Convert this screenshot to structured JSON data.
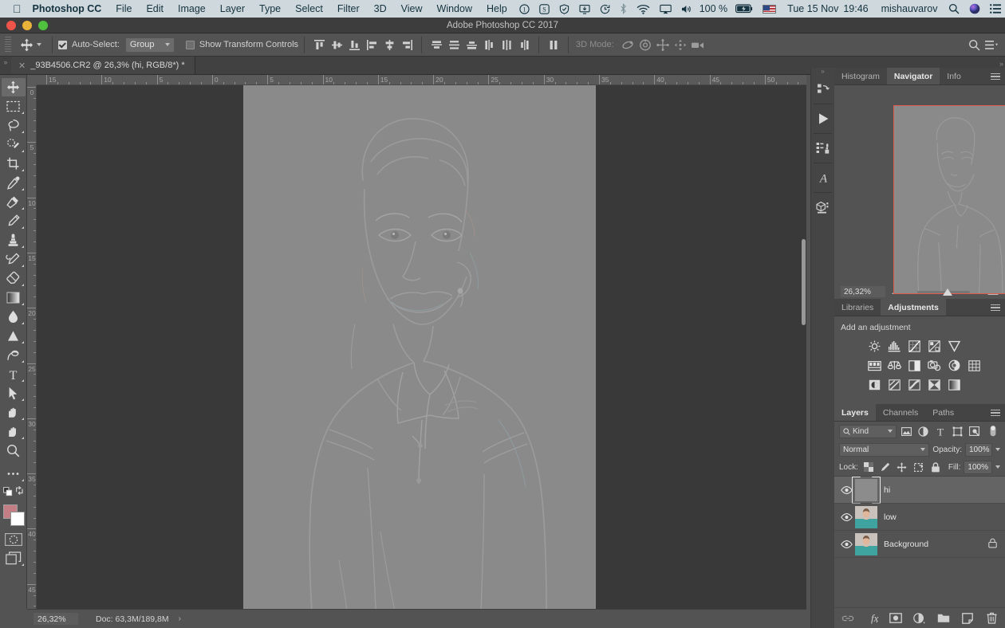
{
  "macbar": {
    "apple_icon": "apple-logo-icon",
    "menus": [
      "Photoshop CC",
      "File",
      "Edit",
      "Image",
      "Layer",
      "Type",
      "Select",
      "Filter",
      "3D",
      "View",
      "Window",
      "Help"
    ],
    "status_icons": [
      "one-password-icon",
      "shazam-icon",
      "shield-icon",
      "display-icon",
      "time-machine-icon",
      "bluetooth-icon",
      "wifi-icon",
      "airplay-icon",
      "volume-icon"
    ],
    "battery_percent": "100 %",
    "battery_icon": "battery-charging-icon",
    "flag_icon": "us-flag-icon",
    "date": "Tue 15 Nov",
    "time": "19:46",
    "user": "mishauvarov",
    "search_icon": "spotlight-search-icon",
    "siri_icon": "siri-icon",
    "notification_icon": "notification-center-icon"
  },
  "window": {
    "title": "Adobe Photoshop CC 2017",
    "traffic_lights": [
      "close",
      "minimize",
      "zoom"
    ]
  },
  "options_bar": {
    "tool_icon": "move-tool-icon",
    "auto_select_checked": true,
    "auto_select_label": "Auto-Select:",
    "auto_select_value": "Group",
    "show_transform_checked": false,
    "show_transform_label": "Show Transform Controls",
    "align_icons": [
      "align-top-edges-icon",
      "align-vertical-centers-icon",
      "align-bottom-edges-icon",
      "align-left-edges-icon",
      "align-horizontal-centers-icon",
      "align-right-edges-icon"
    ],
    "distribute_icons": [
      "distribute-top-edges-icon",
      "distribute-vertical-centers-icon",
      "distribute-bottom-edges-icon",
      "distribute-left-edges-icon",
      "distribute-horizontal-centers-icon",
      "distribute-right-edges-icon"
    ],
    "auto_align_icon": "auto-align-layers-icon",
    "mode_3d_label": "3D Mode:",
    "mode_3d_icons": [
      "rotate-3d-icon",
      "roll-3d-icon",
      "drag-3d-icon",
      "slide-3d-icon",
      "scale-3d-icon"
    ],
    "search_icon": "search-icon",
    "workspace_icon": "workspace-switcher-icon"
  },
  "tab": {
    "close_icon": "close-tab-icon",
    "title": "_93B4506.CR2 @ 26,3% (hi, RGB/8*) *"
  },
  "toolbar": {
    "tools": [
      {
        "name": "move-tool",
        "active": true,
        "submenu": false
      },
      {
        "name": "rectangular-marquee-tool",
        "active": false,
        "submenu": true
      },
      {
        "name": "lasso-tool",
        "active": false,
        "submenu": true
      },
      {
        "name": "quick-selection-tool",
        "active": false,
        "submenu": true
      },
      {
        "name": "crop-tool",
        "active": false,
        "submenu": true
      },
      {
        "name": "eyedropper-tool",
        "active": false,
        "submenu": true
      },
      {
        "name": "spot-healing-brush-tool",
        "active": false,
        "submenu": true
      },
      {
        "name": "brush-tool",
        "active": false,
        "submenu": true
      },
      {
        "name": "clone-stamp-tool",
        "active": false,
        "submenu": true
      },
      {
        "name": "history-brush-tool",
        "active": false,
        "submenu": true
      },
      {
        "name": "eraser-tool",
        "active": false,
        "submenu": true
      },
      {
        "name": "gradient-tool",
        "active": false,
        "submenu": true
      },
      {
        "name": "blur-tool",
        "active": false,
        "submenu": true
      },
      {
        "name": "dodge-tool",
        "active": false,
        "submenu": true
      },
      {
        "name": "pen-tool",
        "active": false,
        "submenu": true
      },
      {
        "name": "horizontal-type-tool",
        "active": false,
        "submenu": true
      },
      {
        "name": "path-selection-tool",
        "active": false,
        "submenu": true
      },
      {
        "name": "rectangle-tool",
        "active": false,
        "submenu": true
      },
      {
        "name": "hand-tool",
        "active": false,
        "submenu": true
      },
      {
        "name": "zoom-tool",
        "active": false,
        "submenu": false
      }
    ],
    "edit_toolbar_icon": "edit-toolbar-ellipsis-icon",
    "default_colors_icon": "default-colors-icon",
    "swap_colors_icon": "swap-colors-icon",
    "foreground_color": "#c37d84",
    "background_color": "#ffffff",
    "quick_mask_icon": "quick-mask-mode-icon",
    "screen_mode_icon": "screen-mode-icon"
  },
  "rulers": {
    "horizontal": [
      "15",
      "10",
      "5",
      "0",
      "5",
      "10",
      "15",
      "20",
      "25",
      "30",
      "35",
      "40",
      "45",
      "50"
    ],
    "vertical": [
      "0",
      "5",
      "10",
      "15",
      "20",
      "25",
      "30",
      "35",
      "40",
      "45"
    ],
    "unit": "cm"
  },
  "status_bar": {
    "zoom": "26,32%",
    "doc_info": "Doc: 63,3M/189,8M",
    "arrow_icon": "chevron-right-icon"
  },
  "dock": {
    "icons": [
      "history-icon",
      "actions-play-icon",
      "tool-presets-icon",
      "character-styles-icon",
      "3d-panel-icon"
    ]
  },
  "navigator_panel": {
    "tabs": [
      {
        "label": "Histogram",
        "active": false
      },
      {
        "label": "Navigator",
        "active": true
      },
      {
        "label": "Info",
        "active": false
      }
    ],
    "menu_icon": "panel-menu-icon",
    "zoom_value": "26,32%",
    "zoom_out_icon": "zoom-out-mountain-icon",
    "zoom_in_icon": "zoom-in-mountain-icon",
    "slider_position_percent": 49,
    "view_box_color": "#e05a50"
  },
  "adjustments_panel": {
    "tabs": [
      {
        "label": "Libraries",
        "active": false
      },
      {
        "label": "Adjustments",
        "active": true
      }
    ],
    "menu_icon": "panel-menu-icon",
    "heading": "Add an adjustment",
    "rows": [
      [
        "brightness-contrast-icon",
        "levels-icon",
        "curves-icon",
        "exposure-icon",
        "vibrance-icon"
      ],
      [
        "hue-saturation-icon",
        "color-balance-icon",
        "black-white-icon",
        "photo-filter-icon",
        "channel-mixer-icon",
        "color-lookup-icon"
      ],
      [
        "invert-icon",
        "posterize-icon",
        "threshold-icon",
        "selective-color-icon",
        "gradient-map-icon"
      ]
    ]
  },
  "layers_panel": {
    "tabs": [
      {
        "label": "Layers",
        "active": true
      },
      {
        "label": "Channels",
        "active": false
      },
      {
        "label": "Paths",
        "active": false
      }
    ],
    "menu_icon": "panel-menu-icon",
    "filter_value": "Kind",
    "filter_search_icon": "search-icon",
    "filter_icons": [
      "filter-pixel-icon",
      "filter-adjustment-icon",
      "filter-type-icon",
      "filter-shape-icon",
      "filter-smart-object-icon"
    ],
    "filter_toggle_icon": "filter-toggle-icon",
    "blend_mode": "Normal",
    "opacity_label": "Opacity:",
    "opacity_value": "100%",
    "lock_label": "Lock:",
    "lock_icons": [
      "lock-transparent-pixels-icon",
      "lock-image-pixels-icon",
      "lock-position-icon",
      "lock-artboard-nesting-icon",
      "lock-all-icon"
    ],
    "fill_label": "Fill:",
    "fill_value": "100%",
    "layers": [
      {
        "name": "hi",
        "visible": true,
        "selected": true,
        "locked": false,
        "thumb": "gray"
      },
      {
        "name": "low",
        "visible": true,
        "selected": false,
        "locked": false,
        "thumb": "photo"
      },
      {
        "name": "Background",
        "visible": true,
        "selected": false,
        "locked": true,
        "thumb": "photo"
      }
    ],
    "visibility_icon": "eye-icon",
    "lock_badge_icon": "lock-icon",
    "footer_icons": [
      "link-layers-icon",
      "layer-styles-fx-icon",
      "add-layer-mask-icon",
      "new-adjustment-layer-icon",
      "new-group-icon",
      "new-layer-icon",
      "delete-layer-icon"
    ]
  },
  "canvas": {
    "document_name": "_93B4506.CR2",
    "background_color": "#393939",
    "image_base_color": "#8a8a8a",
    "description": "high-pass filtered portrait of a woman in a polo shirt on neutral gray"
  }
}
